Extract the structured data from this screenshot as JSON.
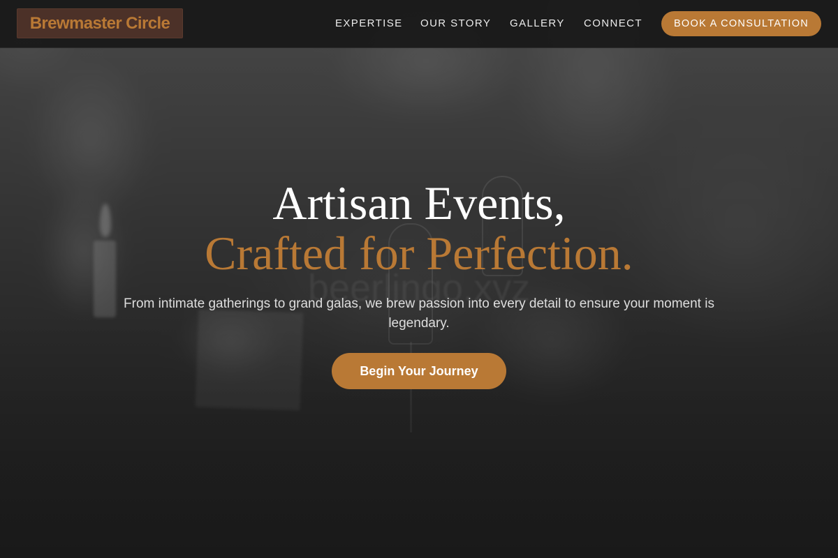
{
  "brand": {
    "name": "Brewmaster Circle",
    "accent_color": "#b97935",
    "logo_bg_color": "#4c3128"
  },
  "nav": {
    "links": [
      {
        "label": "EXPERTISE"
      },
      {
        "label": "OUR STORY"
      },
      {
        "label": "GALLERY"
      },
      {
        "label": "CONNECT"
      }
    ],
    "cta_label": "BOOK A CONSULTATION"
  },
  "hero": {
    "title_line1": "Artisan Events,",
    "title_line2": "Crafted for Perfection.",
    "subtitle": "From intimate gatherings to grand galas, we brew passion into every detail to ensure your moment is legendary.",
    "cta_label": "Begin Your Journey",
    "watermark": "beerlingo.xyz",
    "background_image": "blurred grayscale event photo with glasses and candles"
  }
}
